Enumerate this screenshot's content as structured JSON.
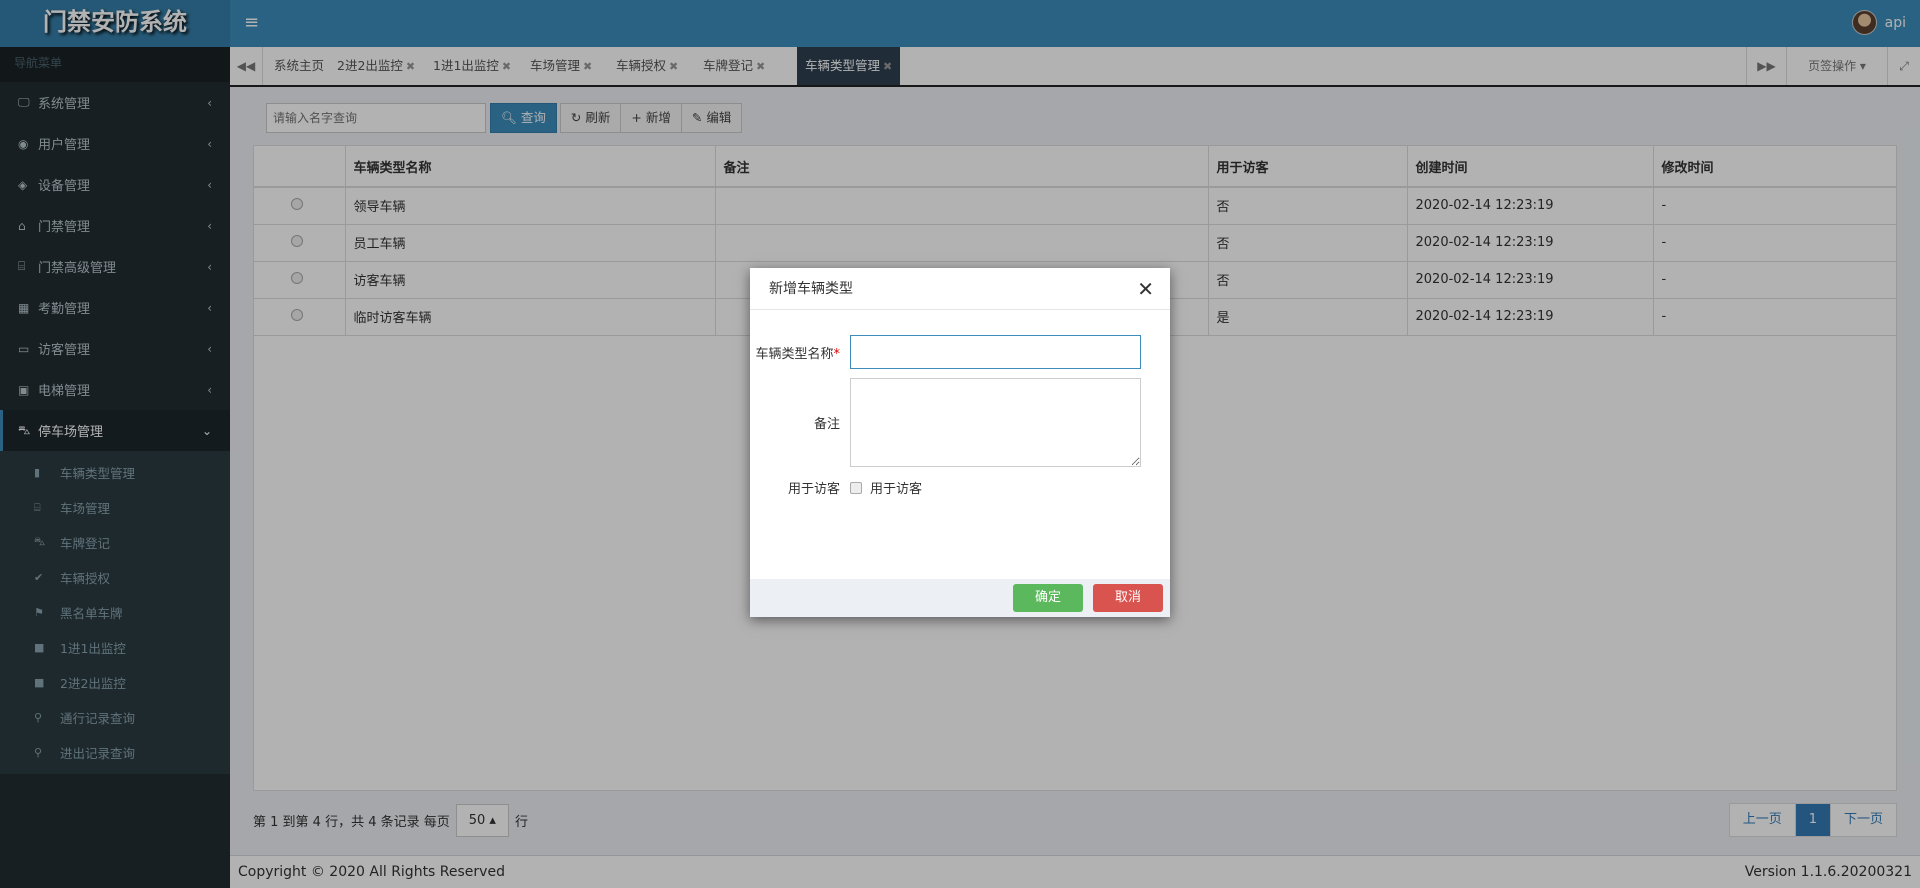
{
  "app": {
    "title": "门禁安防系统",
    "user": "api"
  },
  "sidebar": {
    "header": "导航菜单",
    "items": [
      {
        "label": "系统管理",
        "icon": "desktop-icon"
      },
      {
        "label": "用户管理",
        "icon": "user-icon"
      },
      {
        "label": "设备管理",
        "icon": "cube-icon"
      },
      {
        "label": "门禁管理",
        "icon": "home-icon"
      },
      {
        "label": "门禁高级管理",
        "icon": "bank-icon"
      },
      {
        "label": "考勤管理",
        "icon": "calendar-icon"
      },
      {
        "label": "访客管理",
        "icon": "id-card-icon"
      },
      {
        "label": "电梯管理",
        "icon": "elevator-icon"
      },
      {
        "label": "停车场管理",
        "icon": "car-icon"
      }
    ],
    "subitems": [
      "车辆类型管理",
      "车场管理",
      "车牌登记",
      "车辆授权",
      "黑名单车牌",
      "1进1出监控",
      "2进2出监控",
      "通行记录查询",
      "进出记录查询"
    ]
  },
  "tabs": {
    "items": [
      "系统主页",
      "2进2出监控",
      "1进1出监控",
      "车场管理",
      "车辆授权",
      "车牌登记",
      "车辆类型管理"
    ],
    "active": "车辆类型管理",
    "page_ops": "页签操作"
  },
  "toolbar": {
    "search_placeholder": "请输入名字查询",
    "query": "查询",
    "refresh": "刷新",
    "add": "新增",
    "edit": "编辑"
  },
  "table": {
    "headers": [
      "车辆类型名称",
      "备注",
      "用于访客",
      "创建时间",
      "修改时间"
    ],
    "rows": [
      [
        "领导车辆",
        "",
        "否",
        "2020-02-14 12:23:19",
        "-"
      ],
      [
        "员工车辆",
        "",
        "否",
        "2020-02-14 12:23:19",
        "-"
      ],
      [
        "访客车辆",
        "",
        "否",
        "2020-02-14 12:23:19",
        "-"
      ],
      [
        "临时访客车辆",
        "",
        "是",
        "2020-02-14 12:23:19",
        "-"
      ]
    ]
  },
  "pagination": {
    "info": "第 1 到第 4 行，共 4 条记录 每页",
    "page_size": "50",
    "rows_suffix": "行",
    "prev": "上一页",
    "current": "1",
    "next": "下一页"
  },
  "footer": {
    "copyright": "Copyright © 2020 All Rights Reserved",
    "version": "Version 1.1.6.20200321"
  },
  "modal": {
    "title": "新增车辆类型",
    "name_label": "车辆类型名称",
    "required": "*",
    "note_label": "备注",
    "visitor_label": "用于访客",
    "visitor_checkbox": "用于访客",
    "ok": "确定",
    "cancel": "取消"
  }
}
